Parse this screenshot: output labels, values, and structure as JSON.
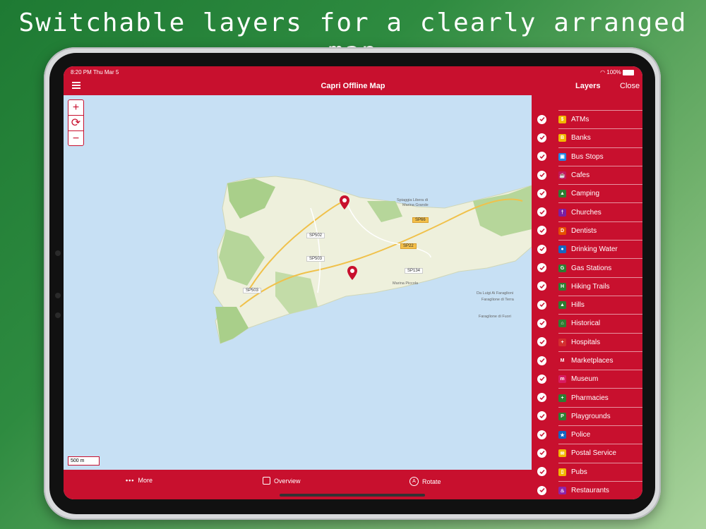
{
  "headline": "Switchable layers for a clearly arranged map",
  "status": {
    "time": "8:20 PM  Thu Mar 5",
    "battery": "100%"
  },
  "app": {
    "title": "Capri Offline Map",
    "layers_label": "Layers",
    "close_label": "Close"
  },
  "map": {
    "scale_label": "500 m",
    "road_labels": [
      "SP502",
      "SP503",
      "SP503",
      "SP66",
      "SP22",
      "SP134"
    ],
    "place_labels": [
      "Spiaggia Libera di",
      "Marina Grande",
      "Marina Piccola",
      "Da Luigi Ai Faraglioni",
      "Faraglione di Terra",
      "Faraglione di Fuori"
    ]
  },
  "bottom": {
    "more": "More",
    "overview": "Overview",
    "rotate": "Rotate"
  },
  "layers": [
    {
      "label": "ATMs",
      "icon": "atm-icon",
      "color": "#f2b800",
      "glyph": "$",
      "checked": true
    },
    {
      "label": "Banks",
      "icon": "bank-icon",
      "color": "#f2b800",
      "glyph": "B",
      "checked": true
    },
    {
      "label": "Bus Stops",
      "icon": "bus-icon",
      "color": "#1e88e5",
      "glyph": "▣",
      "checked": true
    },
    {
      "label": "Cafes",
      "icon": "cafe-icon",
      "color": "#c2185b",
      "glyph": "☕",
      "checked": true
    },
    {
      "label": "Camping",
      "icon": "camping-icon",
      "color": "#2e7d32",
      "glyph": "▲",
      "checked": true
    },
    {
      "label": "Churches",
      "icon": "church-icon",
      "color": "#7b1fa2",
      "glyph": "†",
      "checked": true
    },
    {
      "label": "Dentists",
      "icon": "dentist-icon",
      "color": "#e65100",
      "glyph": "D",
      "checked": true
    },
    {
      "label": "Drinking Water",
      "icon": "water-icon",
      "color": "#1565c0",
      "glyph": "●",
      "checked": true
    },
    {
      "label": "Gas Stations",
      "icon": "gas-station-icon",
      "color": "#2e7d32",
      "glyph": "G",
      "checked": true
    },
    {
      "label": "Hiking Trails",
      "icon": "hiking-icon",
      "color": "#2e7d32",
      "glyph": "H",
      "checked": true
    },
    {
      "label": "Hills",
      "icon": "hills-icon",
      "color": "#2e7d32",
      "glyph": "▲",
      "checked": true
    },
    {
      "label": "Historical",
      "icon": "historical-icon",
      "color": "#2e7d32",
      "glyph": "⌂",
      "checked": true
    },
    {
      "label": "Hospitals",
      "icon": "hospital-icon",
      "color": "#d32f2f",
      "glyph": "+",
      "checked": true
    },
    {
      "label": "Marketplaces",
      "icon": "marketplace-icon",
      "color": "#c8102e",
      "glyph": "M",
      "checked": true
    },
    {
      "label": "Museum",
      "icon": "museum-icon",
      "color": "#d81b60",
      "glyph": "m",
      "checked": true
    },
    {
      "label": "Pharmacies",
      "icon": "pharmacy-icon",
      "color": "#2e7d32",
      "glyph": "+",
      "checked": true
    },
    {
      "label": "Playgrounds",
      "icon": "playground-icon",
      "color": "#2e7d32",
      "glyph": "P",
      "checked": true
    },
    {
      "label": "Police",
      "icon": "police-icon",
      "color": "#1565c0",
      "glyph": "★",
      "checked": true
    },
    {
      "label": "Postal Service",
      "icon": "postal-icon",
      "color": "#f2b800",
      "glyph": "✉",
      "checked": true
    },
    {
      "label": "Pubs",
      "icon": "pub-icon",
      "color": "#f2b800",
      "glyph": "▯",
      "checked": true
    },
    {
      "label": "Restaurants",
      "icon": "restaurant-icon",
      "color": "#8e24aa",
      "glyph": "♨",
      "checked": true
    }
  ]
}
